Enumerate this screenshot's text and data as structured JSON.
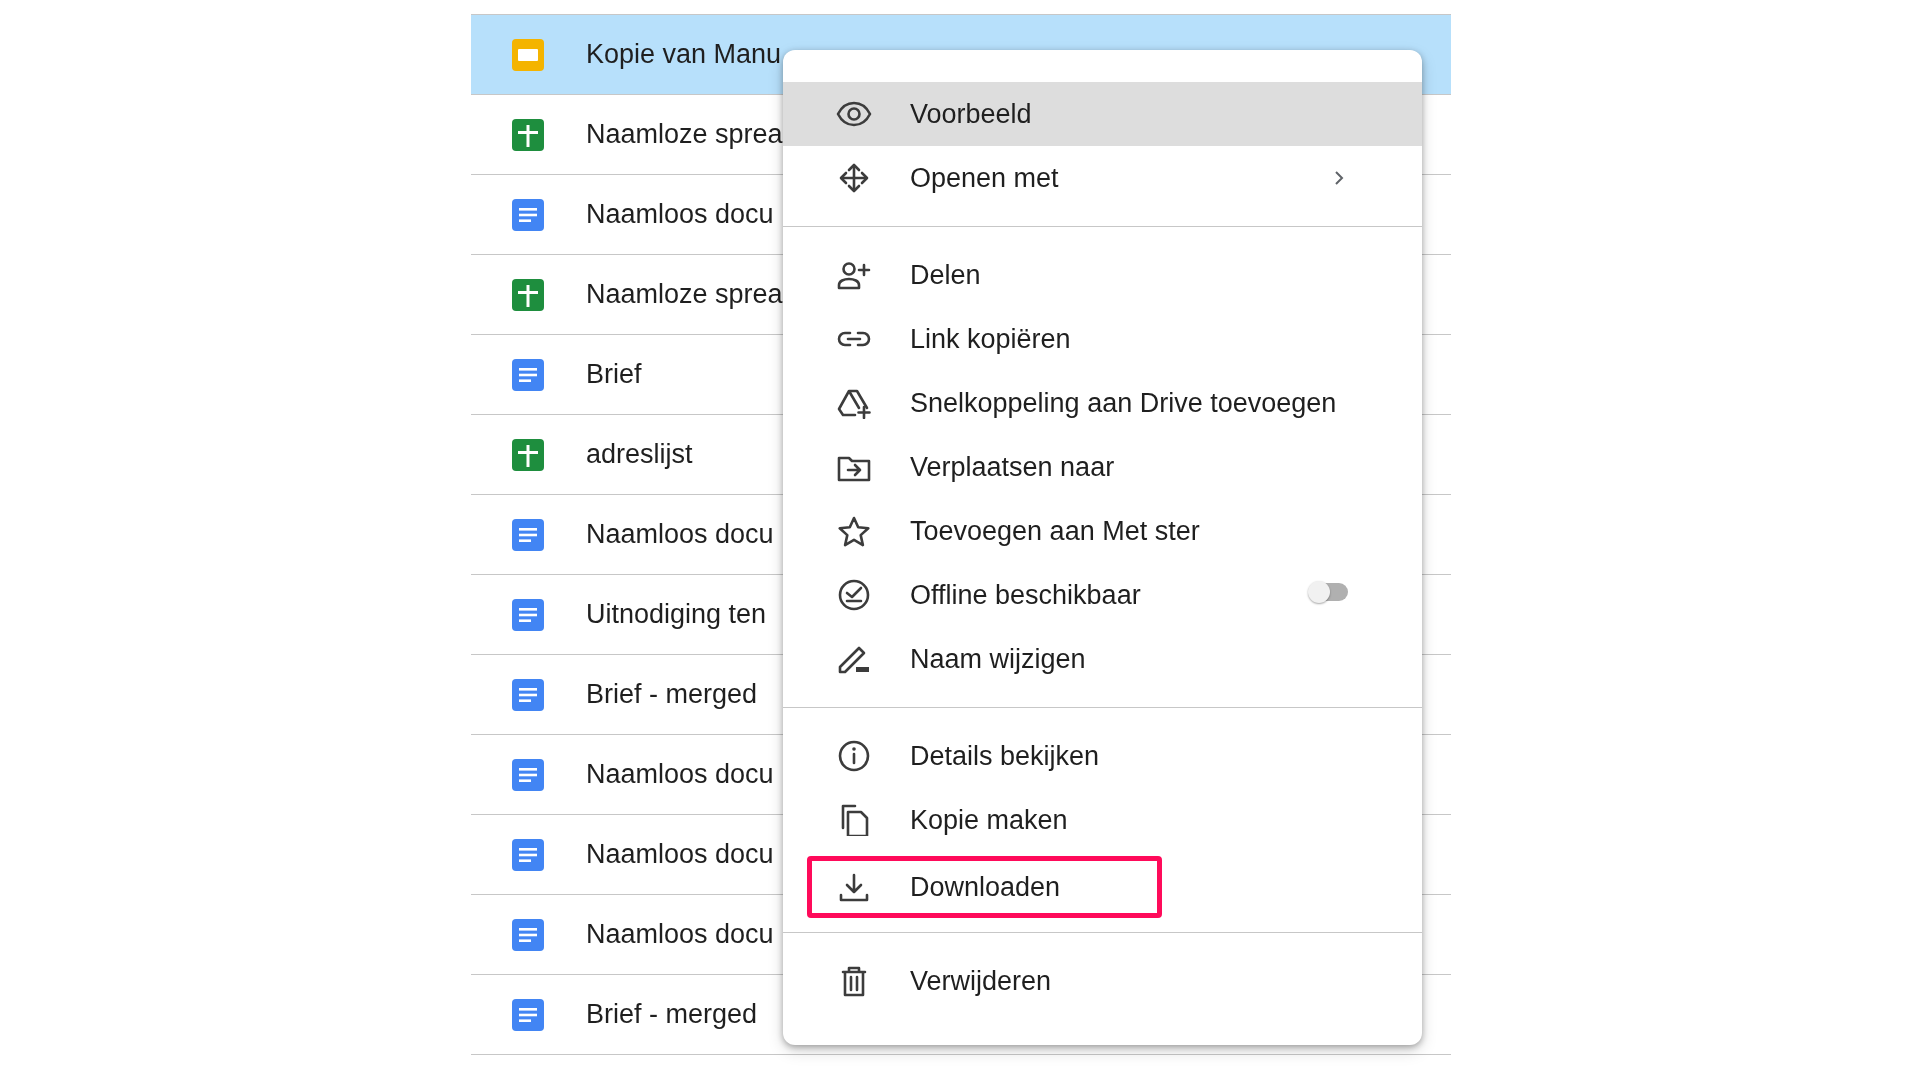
{
  "files": [
    {
      "kind": "slides",
      "name": "Kopie van Manu",
      "selected": true
    },
    {
      "kind": "sheets",
      "name": "Naamloze sprea",
      "selected": false
    },
    {
      "kind": "docs",
      "name": "Naamloos docu",
      "selected": false
    },
    {
      "kind": "sheets",
      "name": "Naamloze sprea",
      "selected": false
    },
    {
      "kind": "docs",
      "name": "Brief",
      "selected": false
    },
    {
      "kind": "sheets",
      "name": "adreslijst",
      "selected": false
    },
    {
      "kind": "docs",
      "name": "Naamloos docu",
      "selected": false
    },
    {
      "kind": "docs",
      "name": "Uitnodiging ten",
      "selected": false
    },
    {
      "kind": "docs",
      "name": "Brief - merged",
      "selected": false
    },
    {
      "kind": "docs",
      "name": "Naamloos docu",
      "selected": false
    },
    {
      "kind": "docs",
      "name": "Naamloos docu",
      "selected": false
    },
    {
      "kind": "docs",
      "name": "Naamloos docu",
      "selected": false
    },
    {
      "kind": "docs",
      "name": "Brief - merged",
      "selected": false
    }
  ],
  "context_menu": {
    "groups": [
      [
        {
          "kind": "plain",
          "label": "Voorbeeld",
          "selected": true,
          "highlighted": false
        },
        {
          "kind": "submenu",
          "label": "Openen met",
          "selected": false,
          "highlighted": false
        }
      ],
      [
        {
          "kind": "plain",
          "label": "Delen",
          "selected": false,
          "highlighted": false
        },
        {
          "kind": "plain",
          "label": "Link kopiëren",
          "selected": false,
          "highlighted": false
        },
        {
          "kind": "plain",
          "label": "Snelkoppeling aan Drive toevoegen",
          "selected": false,
          "highlighted": false
        },
        {
          "kind": "plain",
          "label": "Verplaatsen naar",
          "selected": false,
          "highlighted": false
        },
        {
          "kind": "plain",
          "label": "Toevoegen aan Met ster",
          "selected": false,
          "highlighted": false
        },
        {
          "kind": "toggle",
          "label": "Offline beschikbaar",
          "selected": false,
          "highlighted": false,
          "on": false
        },
        {
          "kind": "plain",
          "label": "Naam wijzigen",
          "selected": false,
          "highlighted": false
        }
      ],
      [
        {
          "kind": "plain",
          "label": "Details bekijken",
          "selected": false,
          "highlighted": false
        },
        {
          "kind": "plain",
          "label": "Kopie maken",
          "selected": false,
          "highlighted": false
        },
        {
          "kind": "plain",
          "label": "Downloaden",
          "selected": false,
          "highlighted": true
        }
      ],
      [
        {
          "kind": "plain",
          "label": "Verwijderen",
          "selected": false,
          "highlighted": false
        }
      ]
    ]
  }
}
